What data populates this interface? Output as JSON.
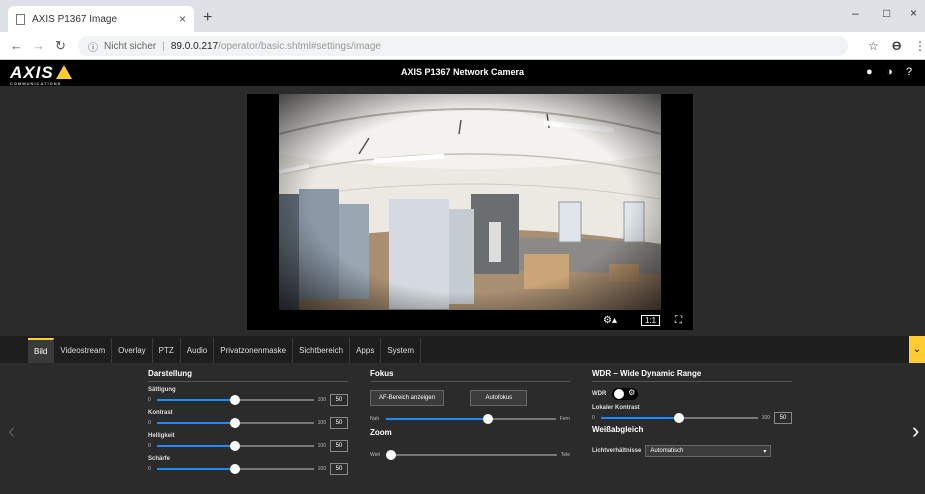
{
  "browser": {
    "tab_title": "AXIS P1367 Image",
    "tab_close": "×",
    "new_tab": "+",
    "win_min": "–",
    "win_max": "□",
    "win_close": "×",
    "url_security": "Nicht sicher",
    "url_host": "89.0.0.217",
    "url_path": "/operator/basic.shtml#settings/image"
  },
  "camera": {
    "brand": "AXIS",
    "brand_sub": "COMMUNICATIONS",
    "title": "AXIS P1367 Network Camera"
  },
  "video_controls": {
    "ratio": "1:1"
  },
  "tabs": [
    "Bild",
    "Videostream",
    "Overlay",
    "PTZ",
    "Audio",
    "Privatzonenmaske",
    "Sichtbereich",
    "Apps",
    "System"
  ],
  "darstellung": {
    "heading": "Darstellung",
    "min_label": "0",
    "max_label": "100",
    "sliders": [
      {
        "label": "Sättigung",
        "value": 50,
        "fraction": 0.5
      },
      {
        "label": "Kontrast",
        "value": 50,
        "fraction": 0.5
      },
      {
        "label": "Helligkeit",
        "value": 50,
        "fraction": 0.5
      },
      {
        "label": "Schärfe",
        "value": 50,
        "fraction": 0.5
      }
    ]
  },
  "fokus": {
    "heading": "Fokus",
    "af_button": "AF-Bereich anzeigen",
    "autofocus_button": "Autofokus",
    "near_label": "Nah",
    "far_label": "Fern",
    "focus_fraction": 0.6,
    "zoom_heading": "Zoom",
    "wide_label": "Weit",
    "tele_label": "Tele",
    "zoom_fraction": 0.0
  },
  "wdr": {
    "heading": "WDR – Wide Dynamic Range",
    "wdr_label": "WDR",
    "local_contrast_label": "Lokaler Kontrast",
    "min_label": "0",
    "max_label": "100",
    "local_contrast_value": 50,
    "local_contrast_fraction": 0.5,
    "wb_heading": "Weißabgleich",
    "light_label": "Lichtverhältnisse",
    "light_value": "Automatisch"
  }
}
